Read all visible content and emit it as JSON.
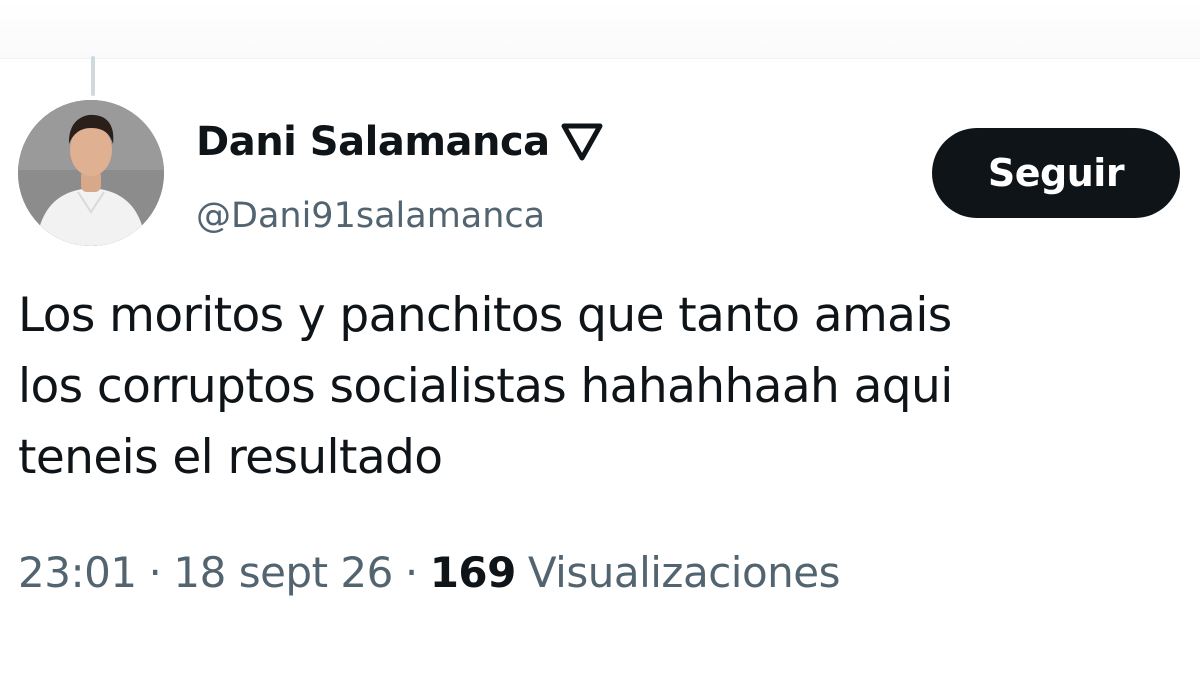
{
  "tweet": {
    "author": {
      "display_name": "Dani Salamanca",
      "handle": "@Dani91salamanca",
      "badge_icon": "triangle-down-icon"
    },
    "follow_label": "Seguir",
    "text_lines": [
      "Los moritos y panchitos que tanto amais",
      "los corruptos socialistas hahahhaah aqui",
      "teneis el resultado"
    ],
    "time": "23:01",
    "separator": "·",
    "date": "18 sept 26",
    "views_count": "169",
    "views_label": "Visualizaciones"
  },
  "colors": {
    "text_primary": "#0f1419",
    "text_secondary": "#536471",
    "button_bg": "#0f1419",
    "button_text": "#ffffff",
    "thread_line": "#cfd9de"
  }
}
